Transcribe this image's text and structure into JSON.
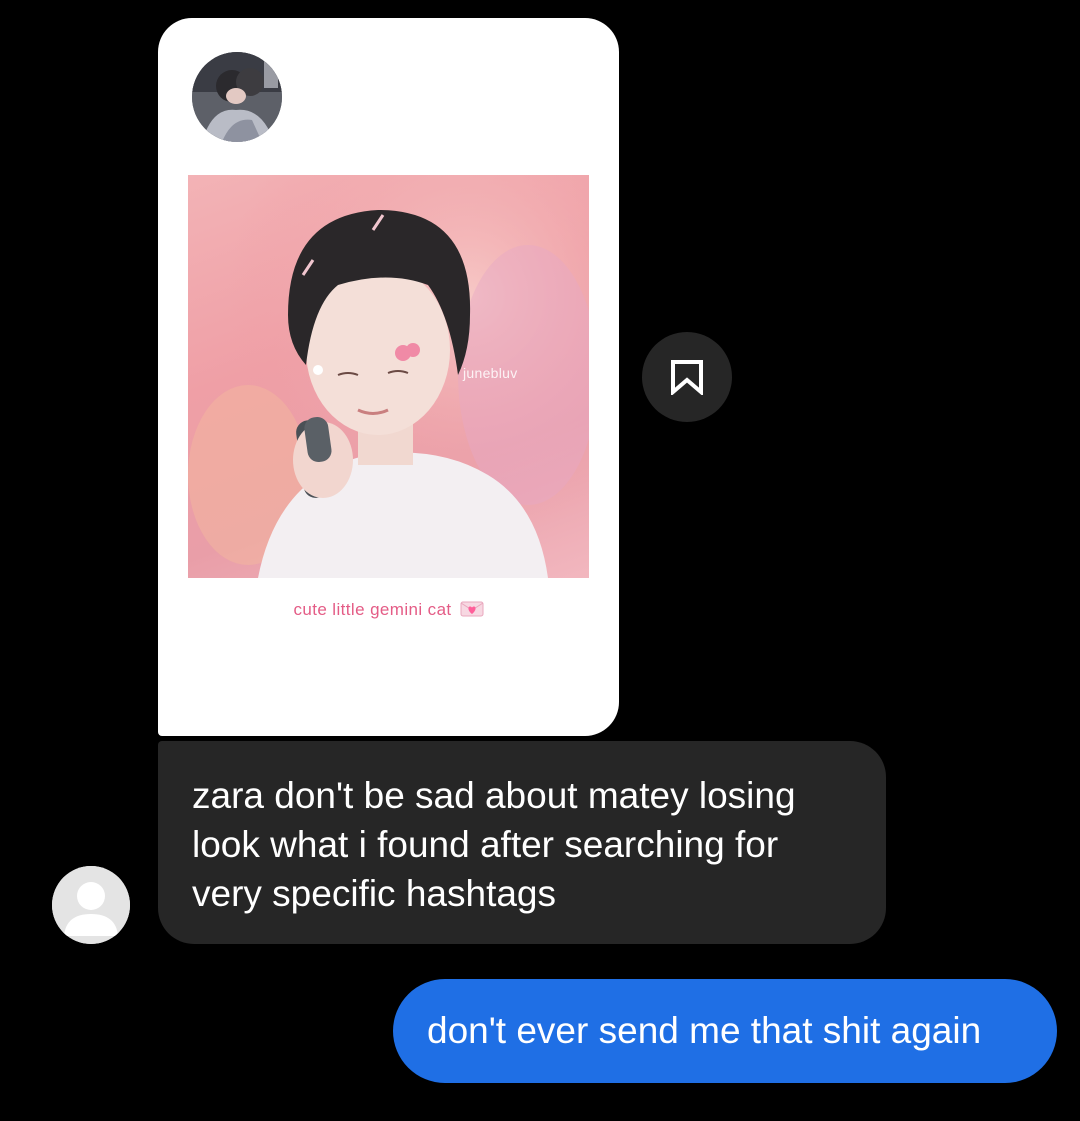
{
  "thread": {
    "shared_post": {
      "caption": "cute little gemini cat",
      "watermark": "junebluv",
      "caption_icon": "pink-heart-envelope-icon"
    },
    "save_button": {
      "icon": "bookmark-icon"
    },
    "messages": [
      {
        "direction": "received",
        "text": "zara don't be sad about matey losing\nlook what i found after searching for\nvery specific hashtags"
      },
      {
        "direction": "sent",
        "text": "don't ever send me that shit again"
      }
    ]
  },
  "colors": {
    "background": "#000000",
    "received_bubble": "#262626",
    "sent_bubble": "#1f6fe5",
    "caption_pink": "#e45c86"
  }
}
